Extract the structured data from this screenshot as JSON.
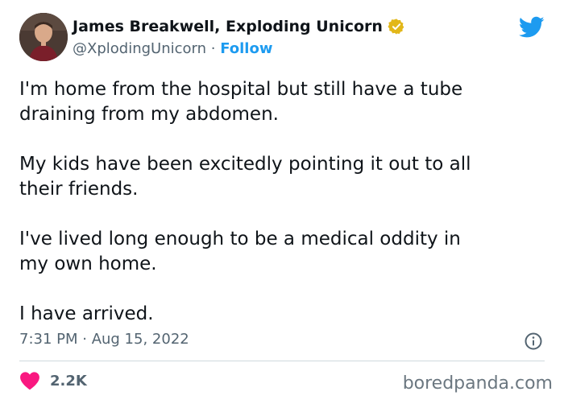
{
  "author": {
    "display_name": "James Breakwell, Exploding Unicorn",
    "handle": "@XplodingUnicorn",
    "separator": " · ",
    "follow_label": "Follow"
  },
  "tweet": {
    "paragraphs": [
      "I'm home from the hospital but still have a tube\ndraining from my abdomen.",
      "My kids have been excitedly pointing it out to all\ntheir friends.",
      "I've lived long enough to be a medical oddity in\nmy own home.",
      "I have arrived."
    ],
    "timestamp": "7:31 PM · Aug 15, 2022"
  },
  "engagement": {
    "likes": "2.2K"
  },
  "watermark": "boredpanda.com",
  "icons": {
    "verified": "verified-badge-icon",
    "platform": "twitter-bird-icon",
    "info": "info-icon",
    "like": "heart-icon"
  },
  "colors": {
    "accent": "#1d9bf0",
    "verified_gold": "#e2b719",
    "heart": "#f91880",
    "secondary_text": "#536471"
  }
}
